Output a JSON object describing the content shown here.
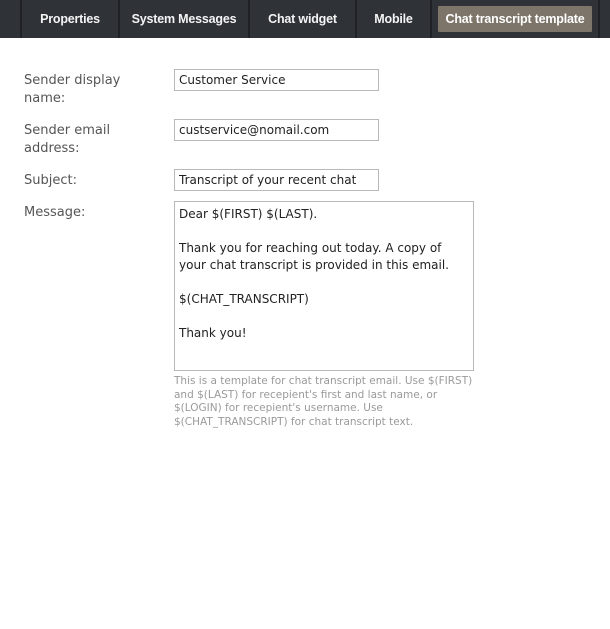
{
  "tabs": [
    {
      "label": "Properties",
      "active": false
    },
    {
      "label": "System Messages",
      "active": false
    },
    {
      "label": "Chat widget",
      "active": false
    },
    {
      "label": "Mobile",
      "active": false
    },
    {
      "label": "Chat transcript template",
      "active": true
    }
  ],
  "form": {
    "sender_name": {
      "label": "Sender display name:",
      "value": "Customer Service"
    },
    "sender_email": {
      "label": "Sender email address:",
      "value": "custservice@nomail.com"
    },
    "subject": {
      "label": "Subject:",
      "value": "Transcript of your recent chat"
    },
    "message": {
      "label": "Message:",
      "value": "Dear $(FIRST) $(LAST).\n\nThank you for reaching out today. A copy of your chat transcript is provided in this email.\n\n$(CHAT_TRANSCRIPT)\n\nThank you!"
    },
    "hint": "This is a template for chat transcript email. Use $(FIRST) and $(LAST) for recepient's first and last name, or $(LOGIN) for recepient's username. Use $(CHAT_TRANSCRIPT) for chat transcript text."
  },
  "colors": {
    "tabbar_bg": "#2f3237",
    "active_tab_bg": "#7d756a"
  }
}
